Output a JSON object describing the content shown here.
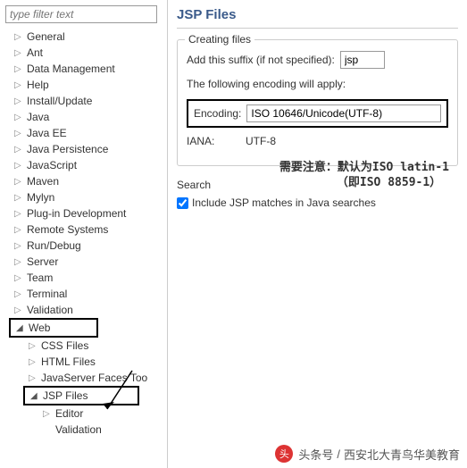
{
  "filter": {
    "placeholder": "type filter text"
  },
  "tree": {
    "items": [
      "General",
      "Ant",
      "Data Management",
      "Help",
      "Install/Update",
      "Java",
      "Java EE",
      "Java Persistence",
      "JavaScript",
      "Maven",
      "Mylyn",
      "Plug-in Development",
      "Remote Systems",
      "Run/Debug",
      "Server",
      "Team",
      "Terminal",
      "Validation"
    ],
    "web": "Web",
    "webChildren": [
      "CSS Files",
      "HTML Files",
      "JavaServer Faces Too"
    ],
    "jsp": "JSP Files",
    "jspChildren": [
      "Editor",
      "Validation"
    ]
  },
  "main": {
    "title": "JSP Files",
    "creating": {
      "legend": "Creating files",
      "suffixLabel": "Add this suffix (if not specified):",
      "suffixValue": "jsp",
      "encodingNote": "The following encoding will apply:",
      "encodingLabel": "Encoding:",
      "encodingValue": "ISO 10646/Unicode(UTF-8)",
      "ianaLabel": "IANA:",
      "ianaValue": "UTF-8"
    },
    "search": {
      "legend": "Search",
      "checkboxLabel": "Include JSP matches in Java searches"
    }
  },
  "annotation": {
    "line1": "需要注意：默认为ISO latin-1",
    "line2": "（即ISO 8859-1）"
  },
  "watermark": {
    "prefix": "头条号",
    "name": "西安北大青鸟华美教育"
  }
}
